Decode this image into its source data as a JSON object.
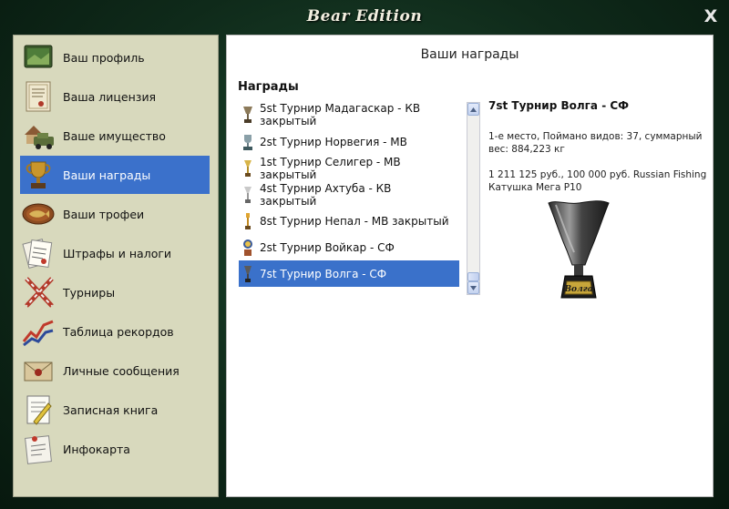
{
  "app": {
    "title": "Bear Edition",
    "close_label": "X"
  },
  "sidebar": {
    "items": [
      {
        "label": "Ваш профиль",
        "icon": "profile-icon"
      },
      {
        "label": "Ваша лицензия",
        "icon": "license-icon"
      },
      {
        "label": "Ваше имущество",
        "icon": "property-icon"
      },
      {
        "label": "Ваши награды",
        "icon": "trophy-icon",
        "active": true
      },
      {
        "label": "Ваши трофеи",
        "icon": "fish-trophy-icon"
      },
      {
        "label": "Штрафы и налоги",
        "icon": "fines-icon"
      },
      {
        "label": "Турниры",
        "icon": "tournaments-icon"
      },
      {
        "label": "Таблица рекордов",
        "icon": "records-chart-icon"
      },
      {
        "label": "Личные сообщения",
        "icon": "messages-icon"
      },
      {
        "label": "Записная книга",
        "icon": "notebook-icon"
      },
      {
        "label": "Инфокарта",
        "icon": "infocard-icon"
      }
    ]
  },
  "main": {
    "title": "Ваши награды",
    "section_label": "Награды",
    "awards": [
      {
        "label": "5st Турнир Мадагаскар - КВ закрытый",
        "icon": "cup-icon"
      },
      {
        "label": "2st Турнир Норвегия - МВ",
        "icon": "cup-icon"
      },
      {
        "label": "1st Турнир Селигер - МВ закрытый",
        "icon": "cup-icon"
      },
      {
        "label": "4st Турнир Ахтуба - КВ закрытый",
        "icon": "cup-icon"
      },
      {
        "label": "8st Турнир Непал - МВ закрытый",
        "icon": "cup-icon"
      },
      {
        "label": "2st Турнир Войкар - СФ",
        "icon": "cup-icon"
      },
      {
        "label": "7st Турнир Волга - СФ",
        "icon": "cup-icon",
        "selected": true
      }
    ],
    "detail": {
      "title": "7st Турнир Волга - СФ",
      "text": "1-е место, Поймано видов: 37, суммарный вес: 884,223 кг",
      "prize": "1 211 125 руб., 100 000 руб. Russian Fishing Катушка Мега Р10",
      "cup_label": "Волга"
    }
  },
  "colors": {
    "accent": "#3b71cb",
    "sidebar_bg": "#d8d9bd",
    "window_bg": "#0f2a1a"
  }
}
